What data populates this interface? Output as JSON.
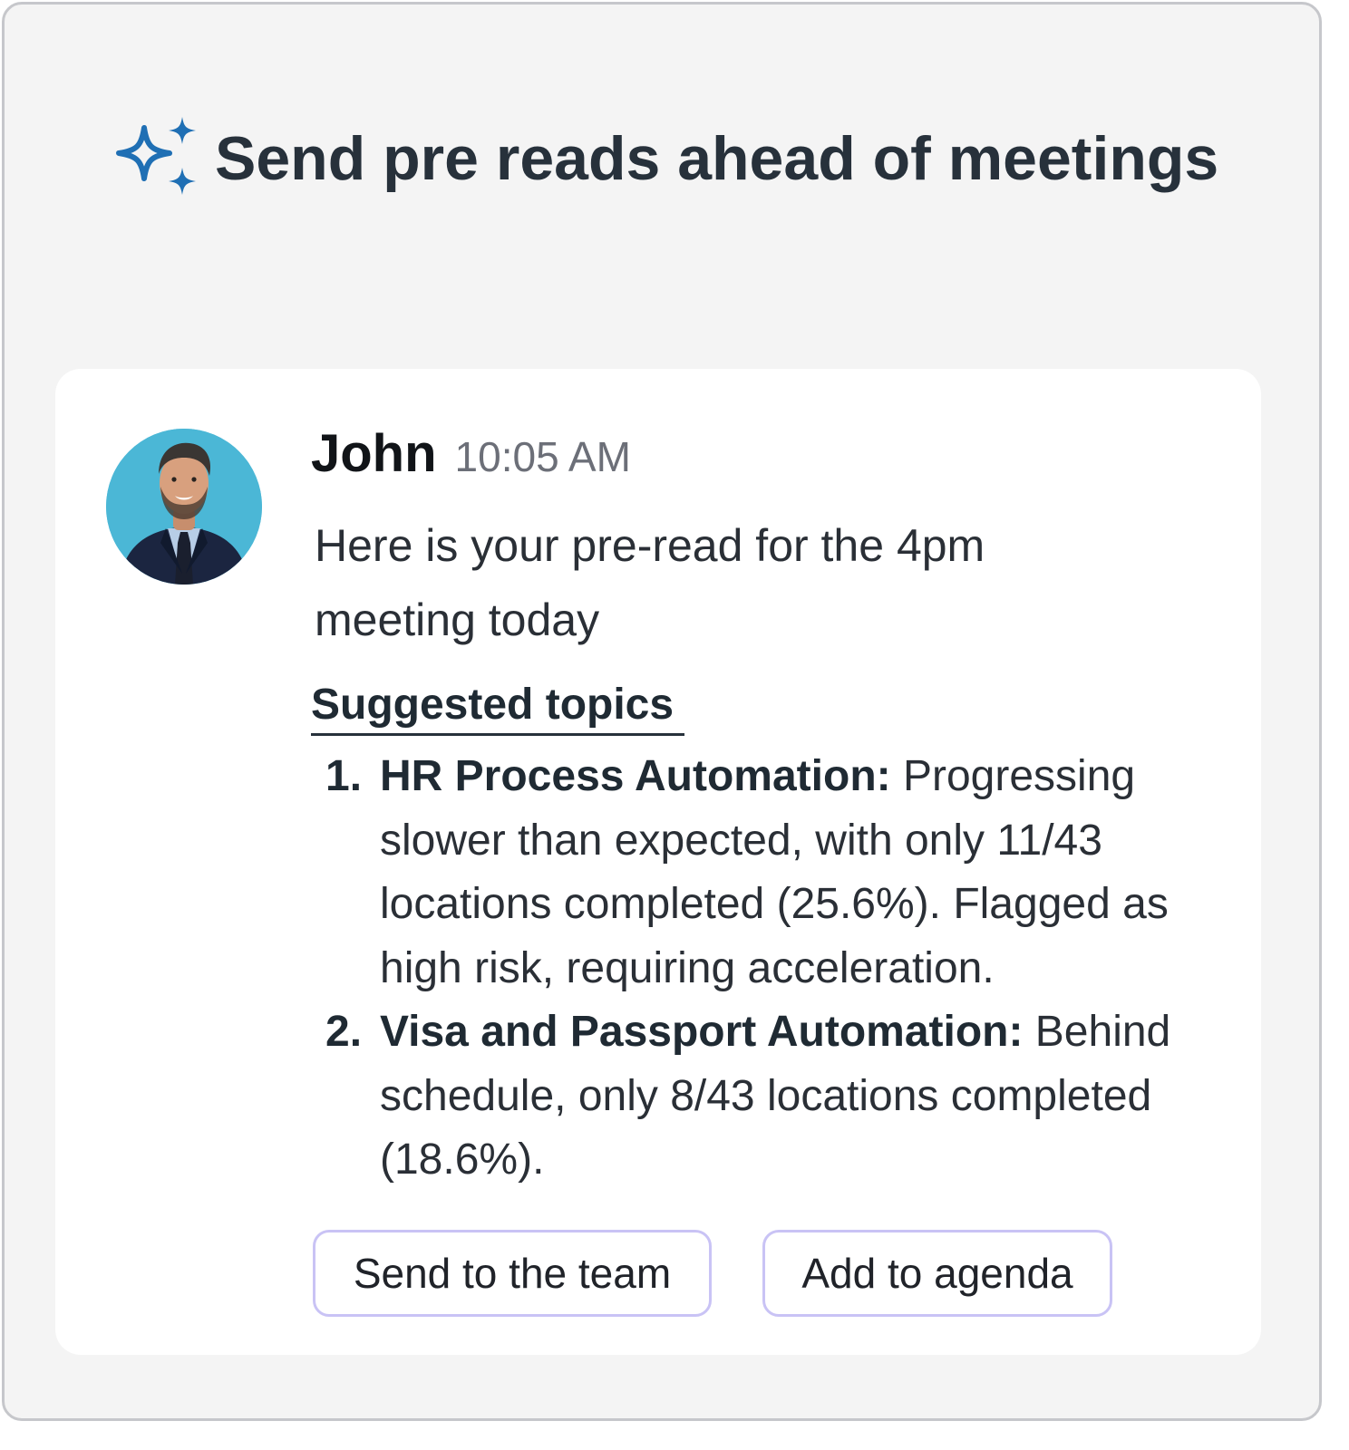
{
  "header": {
    "icon": "sparkle-icon",
    "title": "Send pre reads ahead of meetings",
    "accent_color": "#1f6fb4"
  },
  "message": {
    "avatar": "avatar",
    "sender": "John",
    "time": "10:05 AM",
    "intro": "Here is your pre-read for the 4pm meeting today",
    "section_title": "Suggested topics",
    "topics": [
      {
        "number": "1.",
        "name": "HR Process Automation:",
        "text": " Progressing slower than expected, with only 11/43 locations completed (25.6%). Flagged as high risk, requiring acceleration."
      },
      {
        "number": "2.",
        "name": "Visa and Passport Automation:",
        "text": " Behind schedule, only 8/43 locations completed (18.6%)."
      }
    ]
  },
  "actions": {
    "send_label": "Send to the team",
    "agenda_label": "Add to agenda",
    "button_border_color": "#c9c3f5"
  }
}
